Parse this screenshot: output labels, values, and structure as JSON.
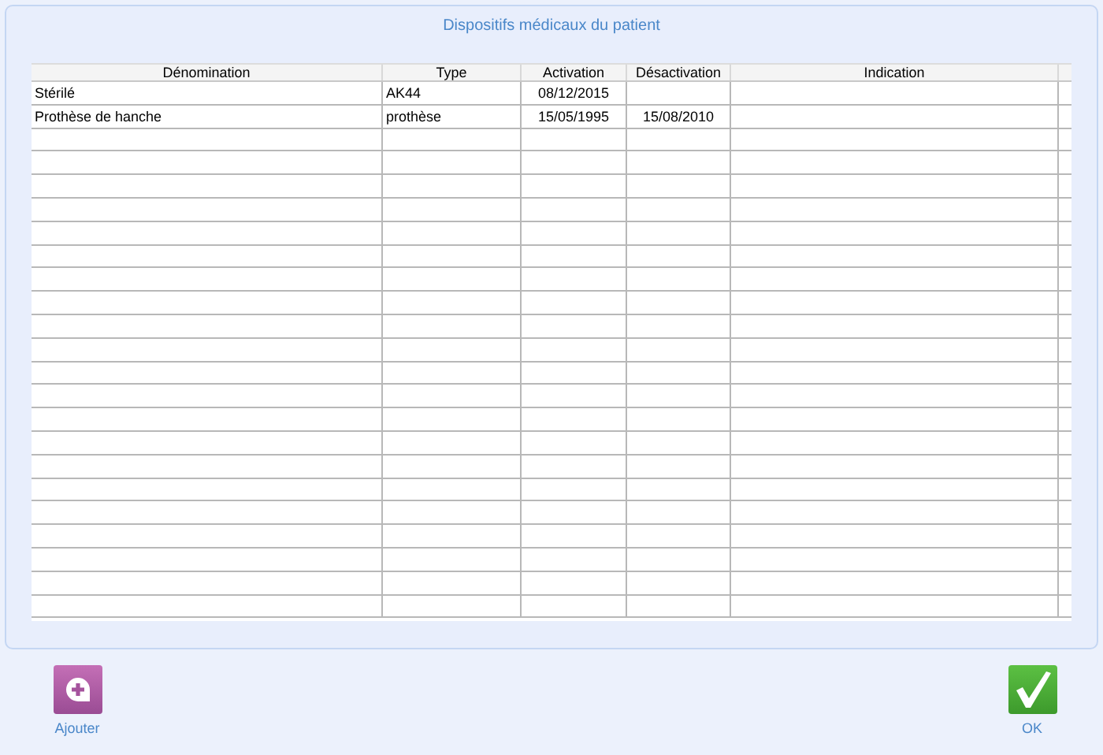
{
  "dialog": {
    "title": "Dispositifs médicaux du patient"
  },
  "table": {
    "columns": [
      "Dénomination",
      "Type",
      "Activation",
      "Désactivation",
      "Indication"
    ],
    "rows": [
      [
        "Stérilé",
        "AK44",
        "08/12/2015",
        "",
        ""
      ],
      [
        "Prothèse de hanche",
        "prothèse",
        "15/05/1995",
        "15/08/2010",
        ""
      ]
    ]
  },
  "buttons": [
    {
      "kind": "add",
      "label": "Ajouter"
    },
    {
      "kind": "ok",
      "label": "OK"
    }
  ]
}
